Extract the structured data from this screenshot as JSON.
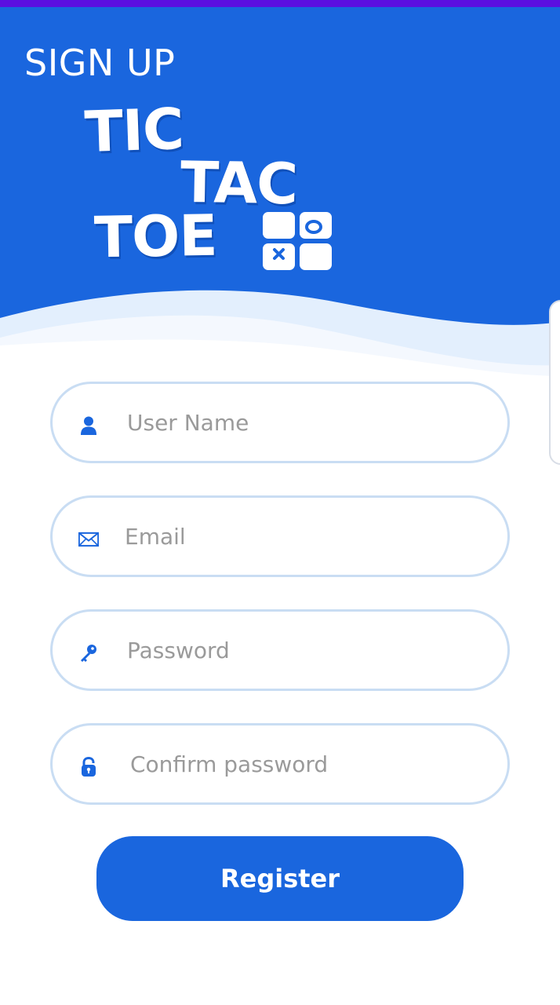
{
  "header": {
    "title": "SIGN UP",
    "logo_words": [
      "TIC",
      "TAC",
      "TOE"
    ]
  },
  "form": {
    "fields": [
      {
        "name": "username",
        "icon": "user-icon",
        "placeholder": "User Name",
        "value": ""
      },
      {
        "name": "email",
        "icon": "envelope-icon",
        "placeholder": "Email",
        "value": ""
      },
      {
        "name": "password",
        "icon": "key-icon",
        "placeholder": "Password",
        "value": ""
      },
      {
        "name": "confirm_password",
        "icon": "lock-icon",
        "placeholder": "Confirm password",
        "value": ""
      }
    ],
    "register_label": "Register"
  },
  "colors": {
    "primary": "#1a66de",
    "status_strip": "#5b0fe0",
    "field_border": "#c9ddf3",
    "placeholder": "#9a9a9a"
  }
}
